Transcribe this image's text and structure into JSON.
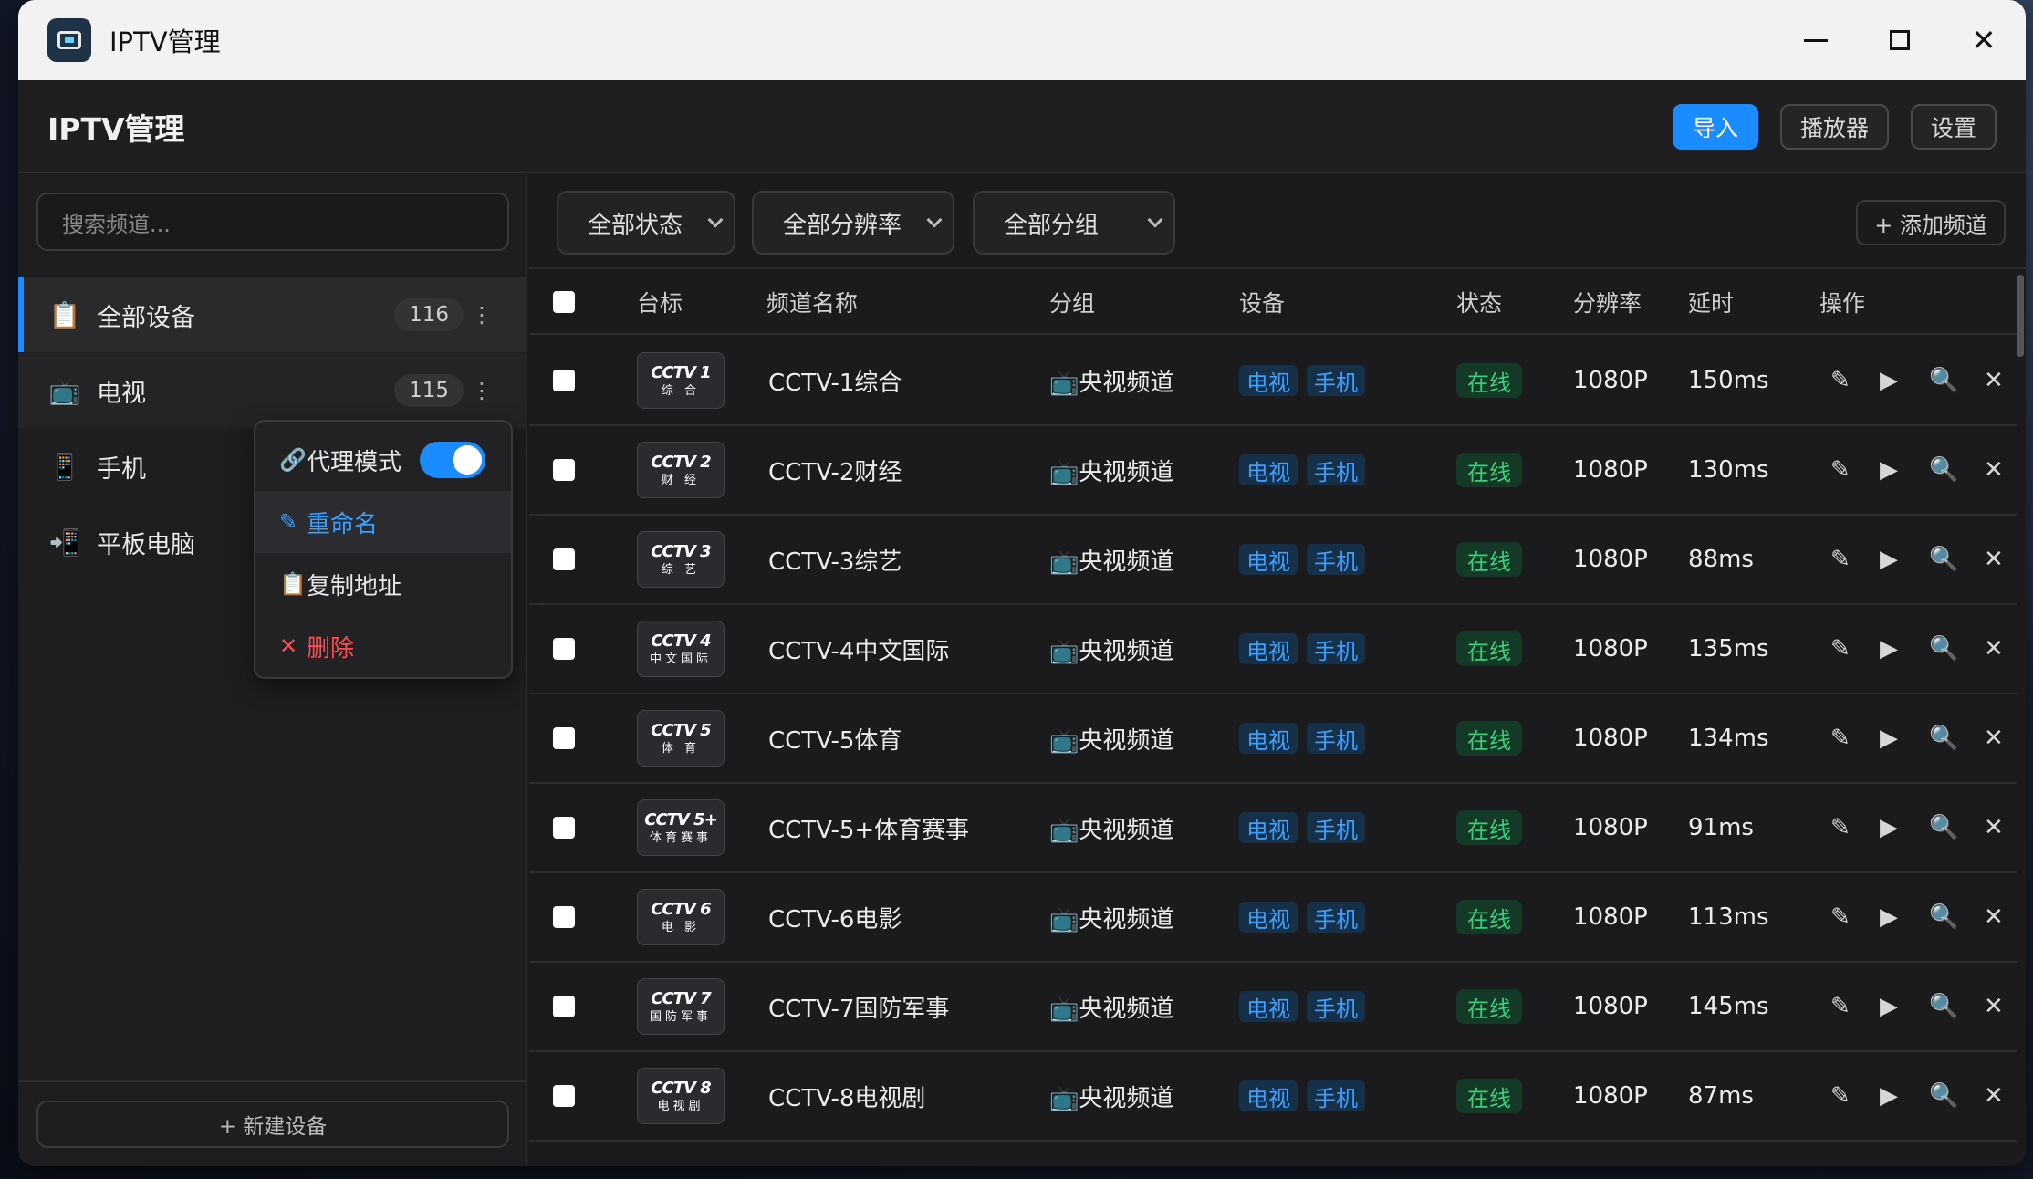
{
  "window": {
    "title": "IPTV管理"
  },
  "header": {
    "title": "IPTV管理",
    "import_label": "导入",
    "player_label": "播放器",
    "settings_label": "设置"
  },
  "sidebar": {
    "search_placeholder": "搜索频道...",
    "devices": [
      {
        "label": "全部设备",
        "count": "116",
        "icon": "clipboard-icon"
      },
      {
        "label": "电视",
        "count": "115",
        "icon": "tv-icon"
      },
      {
        "label": "手机",
        "icon": "phone-icon"
      },
      {
        "label": "平板电脑",
        "icon": "tablet-icon"
      }
    ],
    "new_device_label": "+ 新建设备"
  },
  "context_menu": {
    "proxy_label": "代理模式",
    "proxy_enabled": true,
    "rename_label": "重命名",
    "copy_label": "复制地址",
    "delete_label": "删除"
  },
  "filters": {
    "status": "全部状态",
    "resolution": "全部分辨率",
    "group": "全部分组",
    "add_channel_label": "+ 添加频道"
  },
  "table": {
    "columns": [
      "台标",
      "频道名称",
      "分组",
      "设备",
      "状态",
      "分辨率",
      "延时",
      "操作"
    ],
    "rows": [
      {
        "logo_top": "CCTV 1",
        "logo_bottom": "综 合",
        "name": "CCTV-1综合",
        "group": "📺央视频道",
        "devices": [
          "电视",
          "手机"
        ],
        "status": "在线",
        "resolution": "1080P",
        "latency": "150ms"
      },
      {
        "logo_top": "CCTV 2",
        "logo_bottom": "财 经",
        "name": "CCTV-2财经",
        "group": "📺央视频道",
        "devices": [
          "电视",
          "手机"
        ],
        "status": "在线",
        "resolution": "1080P",
        "latency": "130ms"
      },
      {
        "logo_top": "CCTV 3",
        "logo_bottom": "综 艺",
        "name": "CCTV-3综艺",
        "group": "📺央视频道",
        "devices": [
          "电视",
          "手机"
        ],
        "status": "在线",
        "resolution": "1080P",
        "latency": "88ms"
      },
      {
        "logo_top": "CCTV 4",
        "logo_bottom": "中文国际",
        "name": "CCTV-4中文国际",
        "group": "📺央视频道",
        "devices": [
          "电视",
          "手机"
        ],
        "status": "在线",
        "resolution": "1080P",
        "latency": "135ms"
      },
      {
        "logo_top": "CCTV 5",
        "logo_bottom": "体 育",
        "name": "CCTV-5体育",
        "group": "📺央视频道",
        "devices": [
          "电视",
          "手机"
        ],
        "status": "在线",
        "resolution": "1080P",
        "latency": "134ms"
      },
      {
        "logo_top": "CCTV 5+",
        "logo_bottom": "体育赛事",
        "name": "CCTV-5+体育赛事",
        "group": "📺央视频道",
        "devices": [
          "电视",
          "手机"
        ],
        "status": "在线",
        "resolution": "1080P",
        "latency": "91ms"
      },
      {
        "logo_top": "CCTV 6",
        "logo_bottom": "电 影",
        "name": "CCTV-6电影",
        "group": "📺央视频道",
        "devices": [
          "电视",
          "手机"
        ],
        "status": "在线",
        "resolution": "1080P",
        "latency": "113ms"
      },
      {
        "logo_top": "CCTV 7",
        "logo_bottom": "国防军事",
        "name": "CCTV-7国防军事",
        "group": "📺央视频道",
        "devices": [
          "电视",
          "手机"
        ],
        "status": "在线",
        "resolution": "1080P",
        "latency": "145ms"
      },
      {
        "logo_top": "CCTV 8",
        "logo_bottom": "电视剧",
        "name": "CCTV-8电视剧",
        "group": "📺央视频道",
        "devices": [
          "电视",
          "手机"
        ],
        "status": "在线",
        "resolution": "1080P",
        "latency": "87ms"
      }
    ]
  },
  "colors": {
    "accent": "#1a8cff",
    "online": "#3ccf7a",
    "danger": "#ff4d4f"
  }
}
